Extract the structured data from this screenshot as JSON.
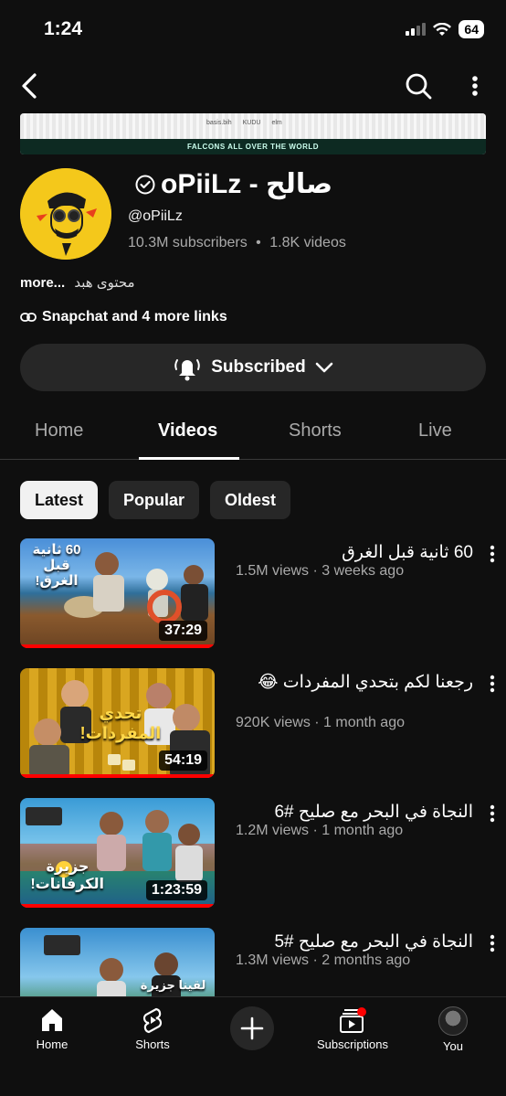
{
  "status": {
    "time": "1:24",
    "battery": "64"
  },
  "banner": {
    "tagline": "FALCONS ALL OVER THE WORLD",
    "logos": [
      "basis.bih",
      "KUDU",
      "elm"
    ]
  },
  "channel": {
    "name": "oPiiLz - صالح",
    "handle": "@oPiiLz",
    "subscribers": "10.3M subscribers",
    "separator": "•",
    "videos": "1.8K videos",
    "description": "محتوى هبد",
    "description_more": "more...",
    "links": "Snapchat and 4 more links",
    "subscribe_label": "Subscribed"
  },
  "tabs": [
    {
      "label": "Home"
    },
    {
      "label": "Videos",
      "active": true
    },
    {
      "label": "Shorts"
    },
    {
      "label": "Live"
    }
  ],
  "chips": [
    {
      "label": "Latest",
      "active": true
    },
    {
      "label": "Popular"
    },
    {
      "label": "Oldest"
    }
  ],
  "videos": [
    {
      "title": "60 ثانية قبل الغرق",
      "views": "1.5M views",
      "age": "3 weeks ago",
      "duration": "37:29",
      "thumb_text": "60 ثانية قبل الغرق!"
    },
    {
      "title": "رجعنا لكم بتحدي المفردات 😂",
      "views": "920K views",
      "age": "1 month ago",
      "duration": "54:19",
      "thumb_text": "تحدي المفردات!"
    },
    {
      "title": "النجاة في البحر مع صليح #6",
      "views": "1.2M views",
      "age": "1 month ago",
      "duration": "1:23:59",
      "thumb_text": "جزيرة الكرفانات!"
    },
    {
      "title": "النجاة في البحر مع صليح #5",
      "views": "1.3M views",
      "age": "2 months ago",
      "duration": "",
      "thumb_text": "لقينا جزيرة"
    }
  ],
  "nav": {
    "home": "Home",
    "shorts": "Shorts",
    "subscriptions": "Subscriptions",
    "you": "You"
  },
  "colors": {
    "background": "#0f0f0f",
    "chip_active": "#f1f1f1",
    "progress": "#ff0000",
    "avatar_bg": "#f4c81b"
  }
}
